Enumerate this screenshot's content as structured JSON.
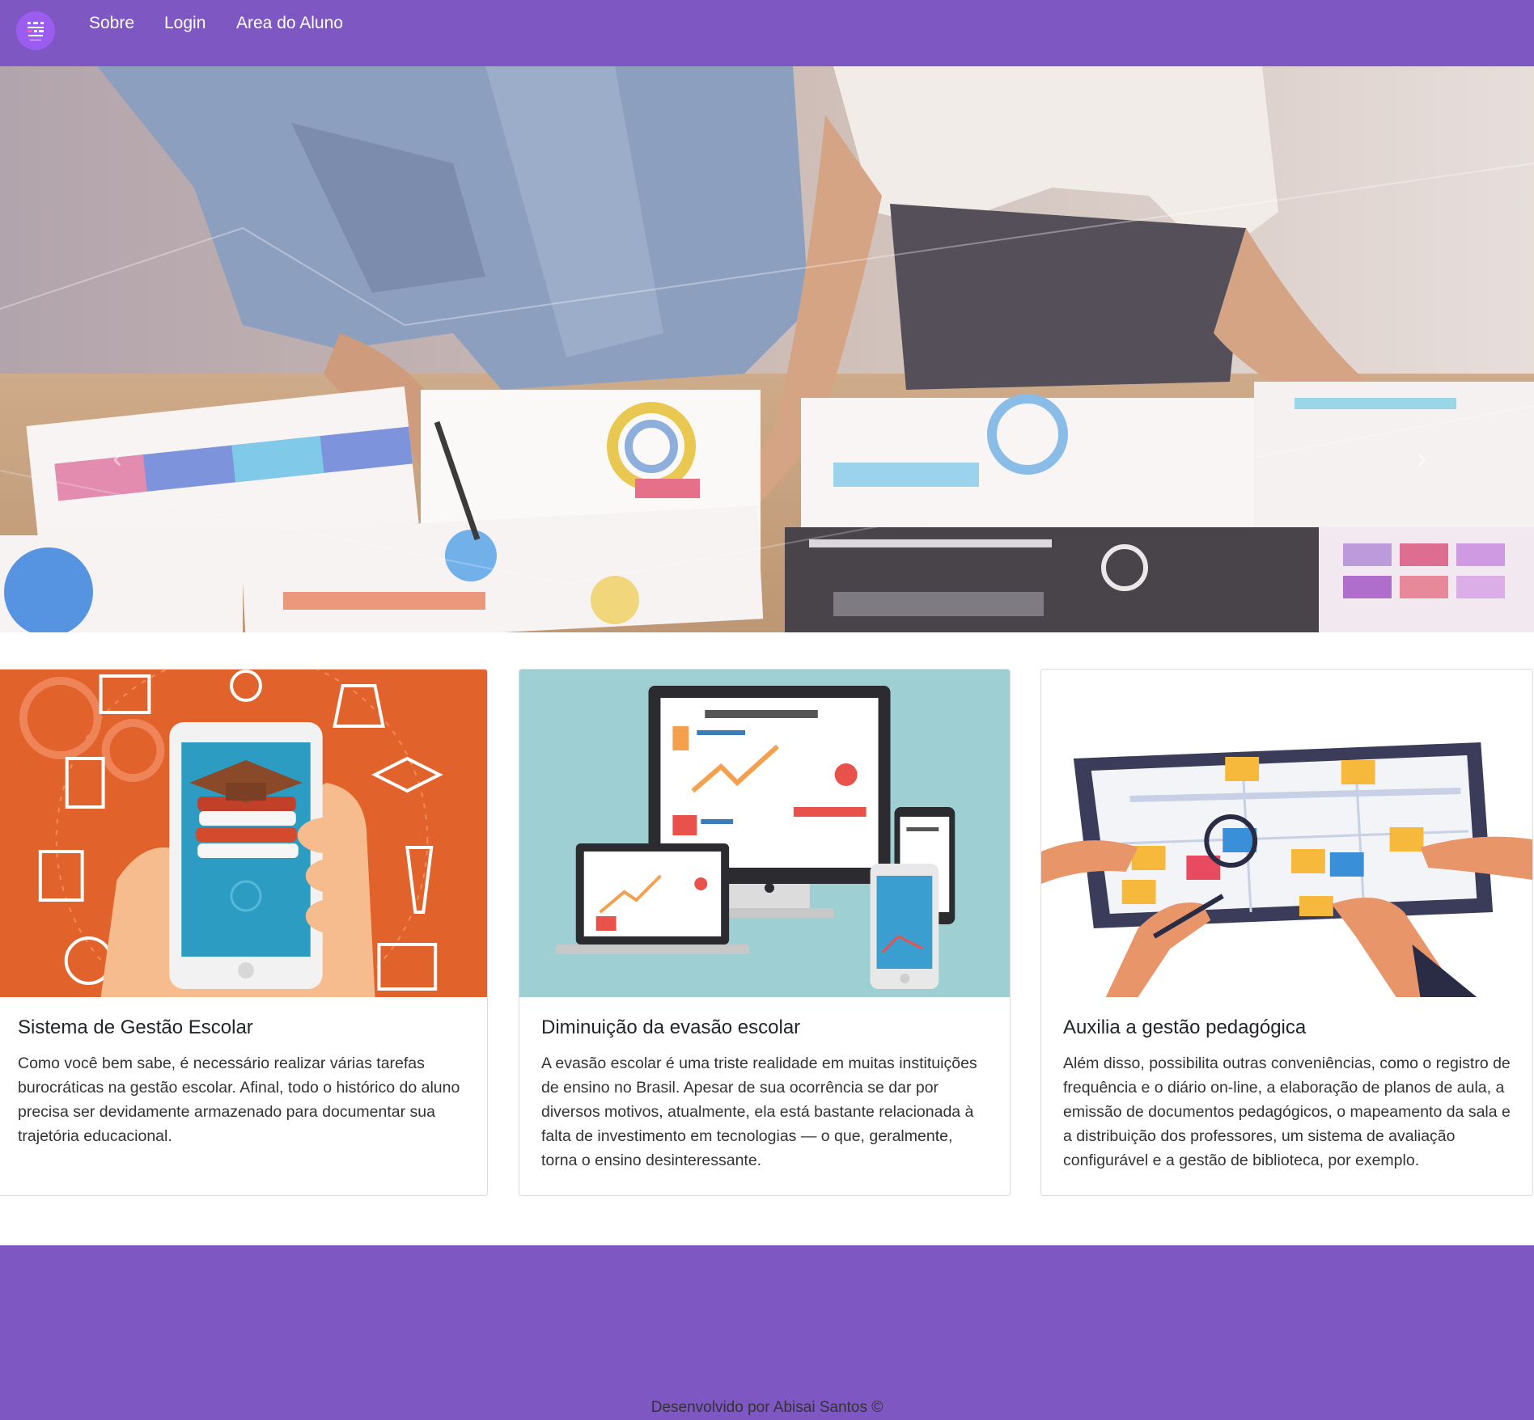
{
  "navbar": {
    "logo_icon": "school-logo-icon",
    "links": [
      "Sobre",
      "Login",
      "Area do Aluno"
    ]
  },
  "hero": {
    "image": "team-analyzing-reports-photo",
    "prev_icon": "chevron-left-icon",
    "next_icon": "chevron-right-icon"
  },
  "cards": [
    {
      "image": "mobile-education-illustration",
      "title": "Sistema de Gestão Escolar",
      "text": "Como você bem sabe, é necessário realizar várias tarefas burocráticas na gestão escolar. Afinal, todo o histórico do aluno precisa ser devidamente armazenado para documentar sua trajetória educacional."
    },
    {
      "image": "multi-device-dashboard-illustration",
      "title": "Diminuição da evasão escolar",
      "text": "A evasão escolar é uma triste realidade em muitas instituições de ensino no Brasil. Apesar de sua ocorrência se dar por diversos motivos, atualmente, ela está bastante relacionada à falta de investimento em tecnologias — o que, geralmente, torna o ensino desinteressante."
    },
    {
      "image": "tablet-planning-board-illustration",
      "title": "Auxilia a gestão pedagógica",
      "text": "Além disso, possibilita outras conveniências, como o registro de frequência e o diário on-line, a elaboração de planos de aula, a emissão de documentos pedagógicos, o mapeamento da sala e a distribuição dos professores, um sistema de avaliação configurável e a gestão de biblioteca, por exemplo."
    }
  ],
  "footer": {
    "credit": "Desenvolvido por Abisai Santos ©"
  },
  "colors": {
    "brand_purple": "#7e57c2",
    "card1_bg": "#e2622b",
    "card2_bg": "#9ecfd2"
  }
}
